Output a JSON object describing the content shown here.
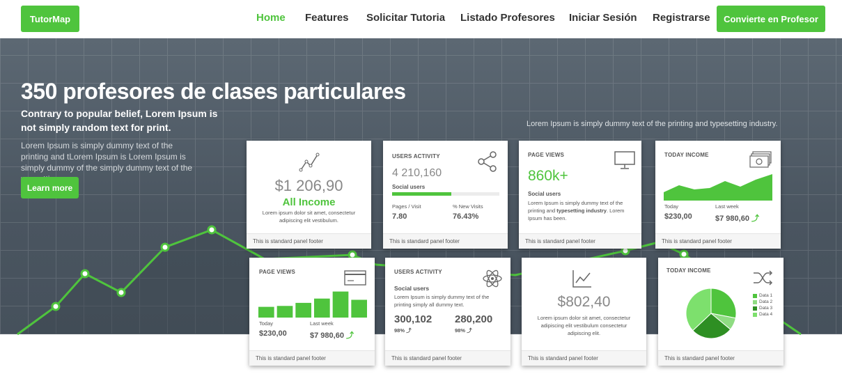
{
  "nav": {
    "logo": "TutorMap",
    "links": [
      "Home",
      "Features",
      "Solicitar Tutoria",
      "Listado Profesores",
      "Iniciar Sesión",
      "Registrarse"
    ],
    "cta": "Convierte en Profesor"
  },
  "hero": {
    "title": "350 profesores de clases particulares",
    "subtitle": "Contrary to popular belief, Lorem Ipsum is not simply random text for print.",
    "body": "Lorem Ipsum is simply dummy text of the printing and tLorem Ipsum is Lorem Ipsum is simply dummy of the simply dummy text of the ypesetting.",
    "button": "Learn more",
    "right_text": "Lorem Ipsum is simply dummy text of the printing and typesetting industry."
  },
  "footer_text": "This is standard panel footer",
  "panels": {
    "income": {
      "icon": "line-chart-icon",
      "amount": "$1 206,90",
      "label": "All Income",
      "desc": "Lorem ipsum dolor sit amet, consectetur adipiscing elit vestibulum."
    },
    "users": {
      "title": "USERS ACTIVITY",
      "icon": "share-icon",
      "value": "4 210,160",
      "sub": "Social users",
      "progress": 0.55,
      "c1_label": "Pages / Visit",
      "c1_value": "7.80",
      "c2_label": "% New Visits",
      "c2_value": "76.43%"
    },
    "pageviews": {
      "title": "PAGE VIEWS",
      "icon": "monitor-icon",
      "value": "860k+",
      "sub": "Social users",
      "desc_a": "Lorem Ipsum is simply dummy text of the printing and ",
      "desc_bold": "typesetting industry",
      "desc_b": ". Lorem Ipsum has been."
    },
    "today1": {
      "title": "TODAY INCOME",
      "icon": "money-icon",
      "c1_label": "Today",
      "c1_value": "$230,00",
      "c2_label": "Last week",
      "c2_value": "$7 980,60",
      "trend": "⤴"
    },
    "pageviews2": {
      "title": "PAGE VIEWS",
      "icon": "credit-card-icon",
      "bars": [
        0.35,
        0.38,
        0.48,
        0.62,
        0.85,
        0.58
      ],
      "c1_label": "Today",
      "c1_value": "$230,00",
      "c2_label": "Last week",
      "c2_value": "$7 980,60",
      "trend": "⤴"
    },
    "users2": {
      "title": "USERS ACTIVITY",
      "icon": "atom-icon",
      "sub": "Social users",
      "desc": "Lorem Ipsum is simply dummy text of the printing simply all dummy text.",
      "v1": "300,102",
      "v1_pct": "98% ⤴",
      "v2": "280,200",
      "v2_pct": "98% ⤴"
    },
    "stat": {
      "icon": "area-chart-icon",
      "amount": "$802,40",
      "desc": "Lorem ipsum dolor sit amet, consectetur adipiscing elit vestibulum consectetur adipiscing elit."
    },
    "today2": {
      "title": "TODAY INCOME",
      "icon": "shuffle-icon",
      "pie": [
        {
          "label": "Data 1",
          "value": 28,
          "color": "#4fc43d"
        },
        {
          "label": "Data 2",
          "value": 8,
          "color": "#8fdc82"
        },
        {
          "label": "Data 3",
          "value": 27,
          "color": "#2e8f23"
        },
        {
          "label": "Data 4",
          "value": 37,
          "color": "#7de06d"
        }
      ]
    }
  },
  "colors": {
    "accent": "#4fc43d",
    "hero_bg": "#4f5a65"
  }
}
